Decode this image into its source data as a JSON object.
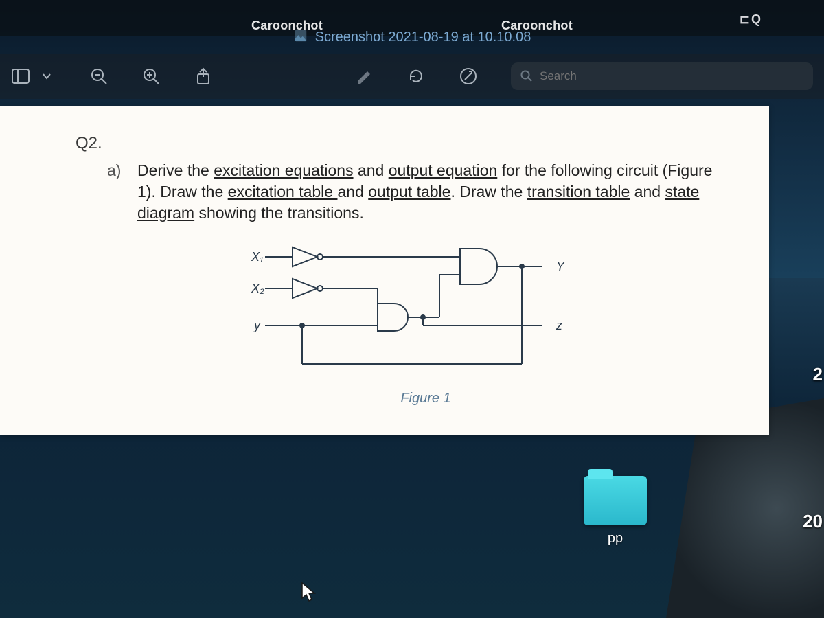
{
  "topbar": {
    "tabs": [
      "Caroonchot",
      "Caroonchot"
    ],
    "right_glyph": "⊏Q"
  },
  "titlebar": {
    "filename": "Screenshot 2021-08-19 at 10.10.08"
  },
  "toolbar": {
    "search_placeholder": "Search"
  },
  "document": {
    "question_number": "Q2.",
    "part_letter": "a)",
    "text_1": "Derive the ",
    "u1": "excitation equations",
    "text_2": " and ",
    "u2": "output equation",
    "text_3": " for the following circuit (Figure 1). Draw the ",
    "u3": "excitation table ",
    "text_4": "and ",
    "u4": "output table",
    "text_5": ". Draw the ",
    "u5": "transition table",
    "text_6": " and ",
    "u6": "state diagram",
    "text_7": " showing the transitions.",
    "labels": {
      "x1": "X₁",
      "x2": "X₂",
      "y_in": "y",
      "Y_out": "Y",
      "z_out": "z"
    },
    "figure_caption": "Figure 1"
  },
  "desktop": {
    "folder_name": "pp"
  },
  "edge_numbers": {
    "upper": "2",
    "lower": "20"
  }
}
